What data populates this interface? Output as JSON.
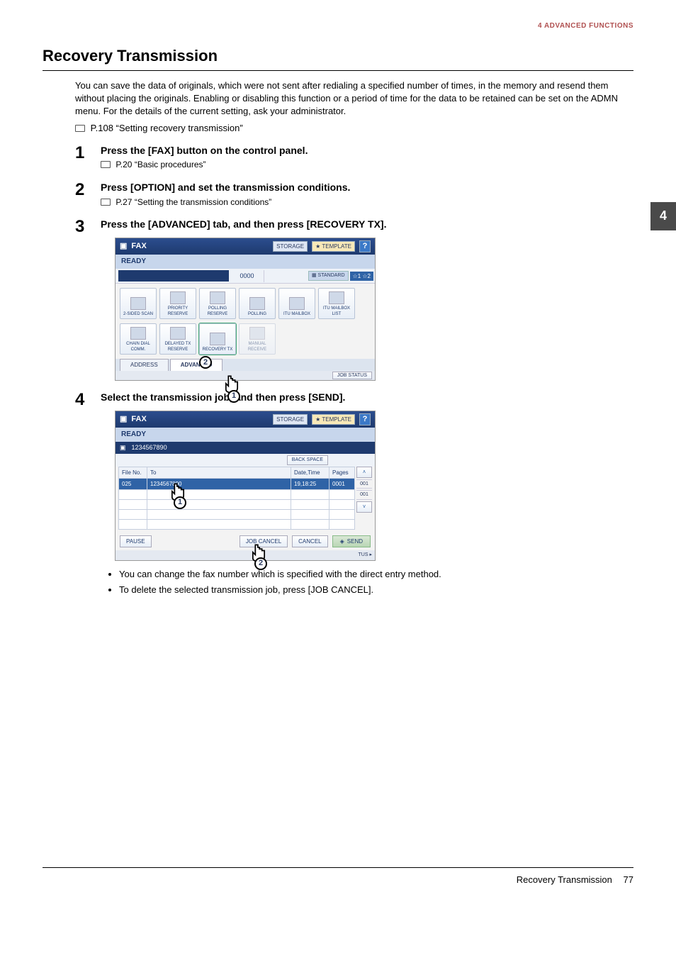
{
  "header": {
    "breadcrumb": "4 ADVANCED FUNCTIONS",
    "thumb": "4"
  },
  "title": "Recovery Transmission",
  "intro": "You can save the data of originals, which were not sent after redialing a specified number of times, in the memory and resend them without placing the originals. Enabling or disabling this function or a period of time for the data to be retained can be set on the ADMN menu. For the details of the current setting, ask your administrator.",
  "intro_xref": "P.108 “Setting recovery transmission”",
  "steps": [
    {
      "head": "Press the [FAX] button on the control panel.",
      "xref": "P.20 “Basic procedures”"
    },
    {
      "head": "Press [OPTION] and set the transmission conditions.",
      "xref": "P.27 “Setting the transmission conditions”"
    },
    {
      "head": "Press the [ADVANCED] tab, and then press [RECOVERY TX]."
    },
    {
      "head": "Select the transmission job, and then press [SEND]."
    }
  ],
  "bullets": [
    "You can change the fax number which is specified with the direct entry method.",
    "To delete the selected transmission job, press [JOB CANCEL]."
  ],
  "footer": {
    "title": "Recovery Transmission",
    "page": "77"
  },
  "screen1": {
    "title": "FAX",
    "storage": "STORAGE",
    "template": "TEMPLATE",
    "help": "?",
    "ready": "READY",
    "count": "0000",
    "standard": "STANDARD",
    "phones": "☆1 ☆2",
    "tiles_row1": [
      "2-SIDED SCAN",
      "PRIORITY RESERVE",
      "POLLING RESERVE",
      "POLLING",
      "ITU MAILBOX",
      "ITU MAILBOX LIST"
    ],
    "tiles_row2": [
      "CHAIN DIAL COMM.",
      "DELAYED TX RESERVE",
      "RECOVERY TX",
      "MANUAL RECEIVE"
    ],
    "tab_address": "ADDRESS",
    "tab_advanced": "ADVANCED",
    "job_status": "JOB STATUS",
    "callout1": "1",
    "callout2": "2"
  },
  "screen2": {
    "title": "FAX",
    "storage": "STORAGE",
    "template": "TEMPLATE",
    "help": "?",
    "ready": "READY",
    "entry_num": "1234567890",
    "backspace": "BACK SPACE",
    "cols": {
      "fileno": "File No.",
      "to": "To",
      "datetime": "Date,Time",
      "pages": "Pages"
    },
    "row": {
      "fileno": "025",
      "to": "1234567890",
      "datetime": "19,18:25",
      "pages": "0001"
    },
    "scroll_top": "001",
    "scroll_bot": "001",
    "pause": "PAUSE",
    "jobcancel": "JOB CANCEL",
    "cancel": "CANCEL",
    "send": "SEND",
    "status_suffix": "TUS",
    "callout1": "1",
    "callout2": "2"
  }
}
